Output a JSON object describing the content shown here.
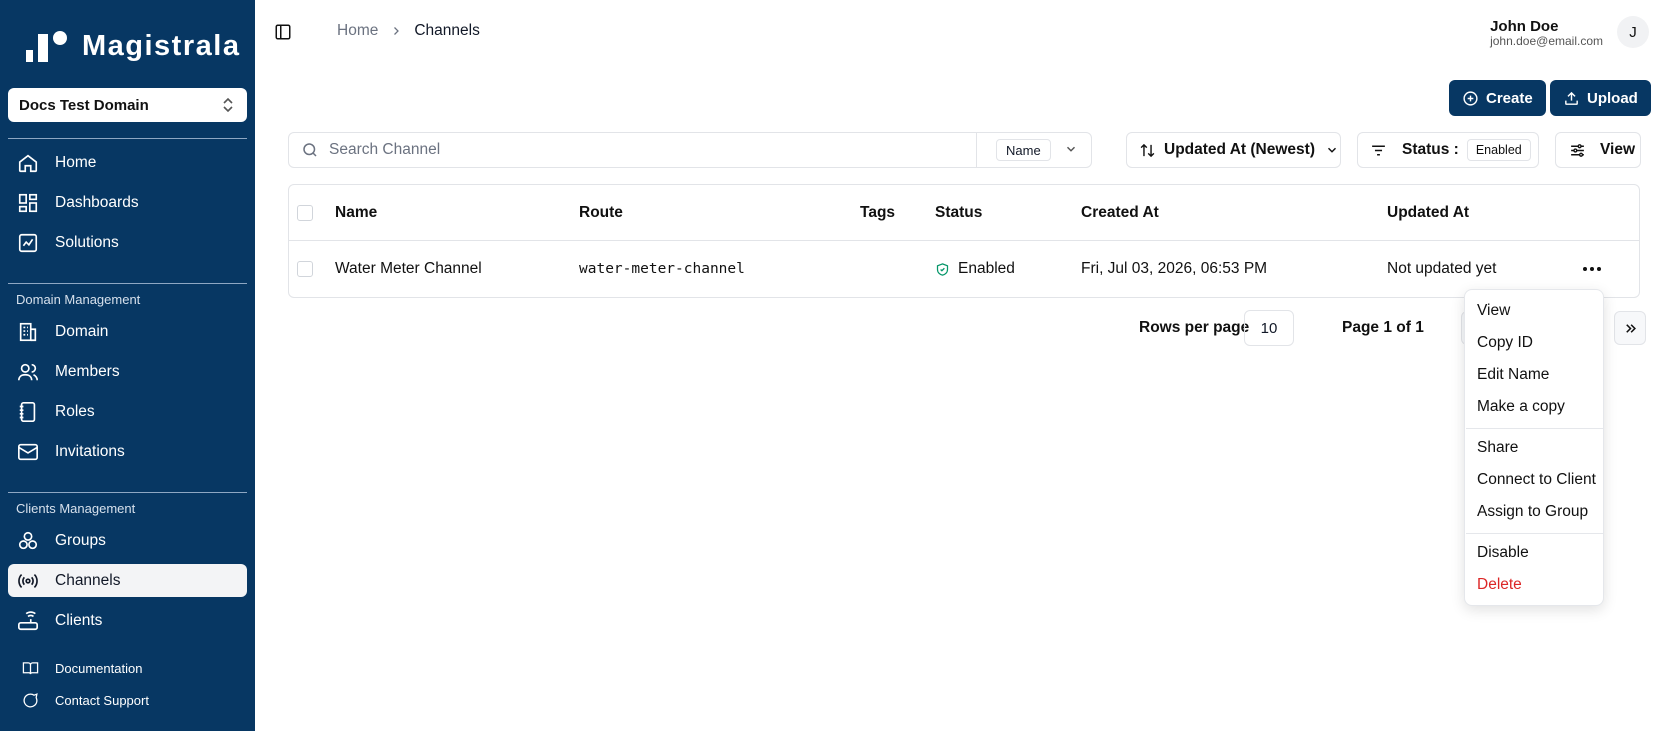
{
  "app": {
    "brand": "Magistrala"
  },
  "sidebar": {
    "domain_selector": "Docs Test Domain",
    "main_items": [
      {
        "label": "Home",
        "icon": "home-icon"
      },
      {
        "label": "Dashboards",
        "icon": "dashboard-icon"
      },
      {
        "label": "Solutions",
        "icon": "solutions-icon"
      }
    ],
    "domain_management": {
      "title": "Domain Management",
      "items": [
        {
          "label": "Domain",
          "icon": "building-icon"
        },
        {
          "label": "Members",
          "icon": "users-icon"
        },
        {
          "label": "Roles",
          "icon": "notebook-icon"
        },
        {
          "label": "Invitations",
          "icon": "mail-icon"
        }
      ]
    },
    "clients_management": {
      "title": "Clients Management",
      "items": [
        {
          "label": "Groups",
          "icon": "groups-icon"
        },
        {
          "label": "Channels",
          "icon": "radio-icon",
          "active": true
        },
        {
          "label": "Clients",
          "icon": "router-icon"
        }
      ]
    },
    "footer": [
      {
        "label": "Documentation",
        "icon": "book-icon"
      },
      {
        "label": "Contact Support",
        "icon": "chat-icon"
      }
    ]
  },
  "header": {
    "breadcrumb": [
      "Home",
      "Channels"
    ],
    "user": {
      "name": "John Doe",
      "email": "john.doe@email.com",
      "initial": "J"
    }
  },
  "toolbar": {
    "create_label": "Create",
    "upload_label": "Upload"
  },
  "filters": {
    "search_placeholder": "Search Channel",
    "search_field": "Name",
    "sort_label": "Updated At (Newest)",
    "status_label": "Status :",
    "status_value": "Enabled",
    "view_label": "View"
  },
  "table": {
    "columns": [
      "Name",
      "Route",
      "Tags",
      "Status",
      "Created At",
      "Updated At"
    ],
    "rows": [
      {
        "name": "Water Meter Channel",
        "route": "water-meter-channel",
        "tags": "",
        "status": "Enabled",
        "created_at": "Fri, Jul 03, 2026, 06:53 PM",
        "updated_at": "Not updated yet"
      }
    ]
  },
  "pagination": {
    "rows_per_page_label": "Rows per page",
    "rows_per_page": "10",
    "page_label": "Page 1 of 1"
  },
  "context_menu": {
    "group1": [
      "View",
      "Copy ID",
      "Edit Name",
      "Make a copy"
    ],
    "group2": [
      "Share",
      "Connect to Client",
      "Assign to Group"
    ],
    "group3": [
      "Disable",
      "Delete"
    ]
  },
  "colors": {
    "sidebar_bg": "#073763",
    "primary": "#073763",
    "danger": "#dc2626",
    "status_ok": "#059669"
  }
}
